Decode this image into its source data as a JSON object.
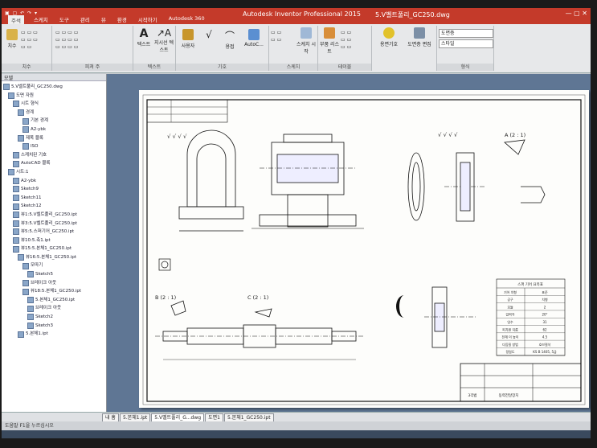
{
  "window": {
    "app_title": "Autodesk Inventor Professional 2015",
    "doc_title": "5.V벨트풀리_GC250.dwg",
    "tabs": [
      "주석",
      "스케치",
      "도구",
      "관리",
      "뷰",
      "환경",
      "시작하기",
      "Autodesk 360"
    ],
    "active_tab": "주석"
  },
  "ribbon": {
    "groups": [
      "치수",
      "피쳐 주",
      "텍스트",
      "기호",
      "스케치",
      "테이블",
      "형식"
    ],
    "buttons": {
      "dimension": "치수",
      "text": "텍스트",
      "leader_text": "지시선 텍스트",
      "surface": "사용자",
      "weld": "용접",
      "autocad": "AutoC...",
      "sketch_start": "스케치 시작",
      "parts_list": "부품 리스트",
      "datum": "용면기호",
      "drawing": "도면층 편집"
    },
    "style_dropdown_1": "도면층",
    "style_dropdown_2": "스타일"
  },
  "browser": {
    "header": "모델",
    "items": [
      "5.V벨트풀리_GC250.dwg",
      "도면 자원",
      "시트 형식",
      "경계",
      "기본 경계",
      "A2-ybk",
      "제목 블록",
      "ISO",
      "스케치된 기호",
      "AutoCAD 블록",
      "시트:1",
      "A2-ybk",
      "Sketch9",
      "Sketch11",
      "Sketch12",
      "뷰1:5.V벨트풀리_GC250.ipt",
      "뷰3:5.V벨트풀리_GC250.ipt",
      "뷰5:5.스퍼기어_GC250.ipt",
      "뷰10:5.축1.ipt",
      "뷰15:5.본체1_GC250.ipt",
      "뷰16:5.본체1_GC250.ipt",
      "모따기",
      "Sketch5",
      "브레이크 아웃",
      "뷰18:5.본체1_GC250.ipt",
      "5.본체1_GC250.ipt",
      "브레이크 아웃",
      "Sketch2",
      "Sketch3",
      "5.본체1.ipt"
    ]
  },
  "drawing": {
    "detail_a": "A (2 : 1)",
    "detail_b": "B (2 : 1)",
    "detail_c": "C (2 : 1)",
    "finish_symbols": "√ √ √ √",
    "table_title": "스퍼 기어 요목표",
    "table_rows": [
      [
        "기어 치형",
        "표준"
      ],
      [
        "공구",
        "치형"
      ],
      [
        "모듈",
        "2"
      ],
      [
        "압력각",
        "20°"
      ],
      [
        "잇수",
        "31"
      ],
      [
        "피치원 지름",
        "62"
      ],
      [
        "전체 이 높이",
        "4.5"
      ],
      [
        "다듬질 방법",
        "호브절삭"
      ],
      [
        "정밀도",
        "KS B 1405, 5급"
      ]
    ],
    "title_block": "동력전달장치",
    "title_block_label": "3각법"
  },
  "status": {
    "sheet_tabs": [
      "내 홈",
      "5.본체1.ipt",
      "5.V벨트풀리_G...dwg",
      "도면1",
      "5.본체1_GC250.ipt"
    ],
    "active_sheet": "5.V벨트풀리_G...dwg",
    "command": "도움말 F1을 누르십시오"
  }
}
